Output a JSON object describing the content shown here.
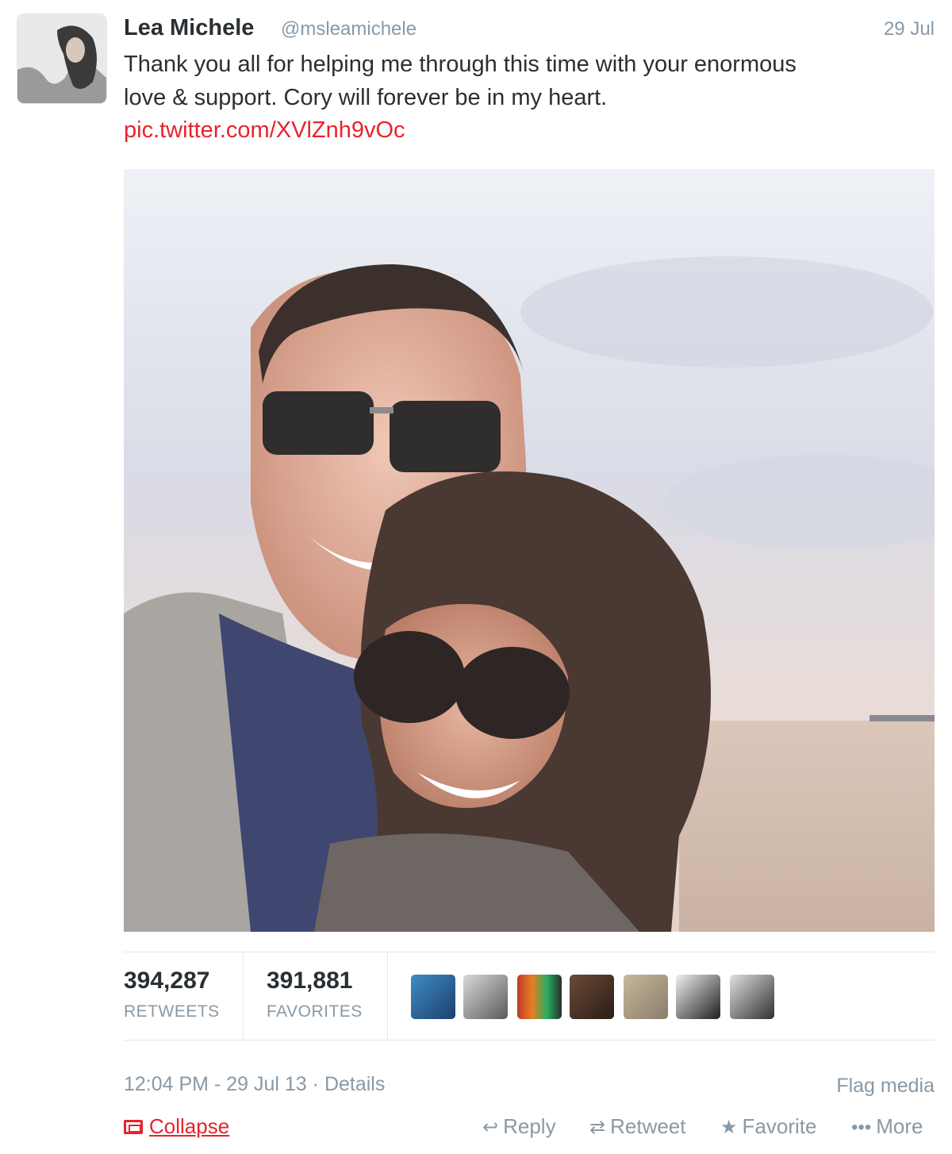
{
  "tweet": {
    "name": "Lea Michele",
    "handle": "@msleamichele",
    "date": "29 Jul",
    "text_lines": [
      "Thank you all for helping me through this time with your enormous",
      "love & support. Cory will forever be in my heart."
    ],
    "link": "pic.twitter.com/XVlZnh9vOc",
    "icons": {
      "avatar": "profile-photo",
      "photo": "attached-photo"
    }
  },
  "stats": {
    "retweets_count": "394,287",
    "retweets_label": "RETWEETS",
    "favorites_count": "391,881",
    "favorites_label": "FAVORITES",
    "faces": [
      "user-avatar-1",
      "user-avatar-2",
      "user-avatar-3",
      "user-avatar-4",
      "user-avatar-5",
      "user-avatar-6",
      "user-avatar-7"
    ]
  },
  "footer": {
    "timestamp": "12:04 PM - 29 Jul 13",
    "separator": "·",
    "details": "Details",
    "flag": "Flag media",
    "collapse": "Collapse",
    "actions": {
      "reply": "Reply",
      "retweet": "Retweet",
      "favorite": "Favorite",
      "more": "More"
    }
  },
  "colors": {
    "link": "#e8232c",
    "muted": "#8899a6",
    "text": "#292f33"
  }
}
